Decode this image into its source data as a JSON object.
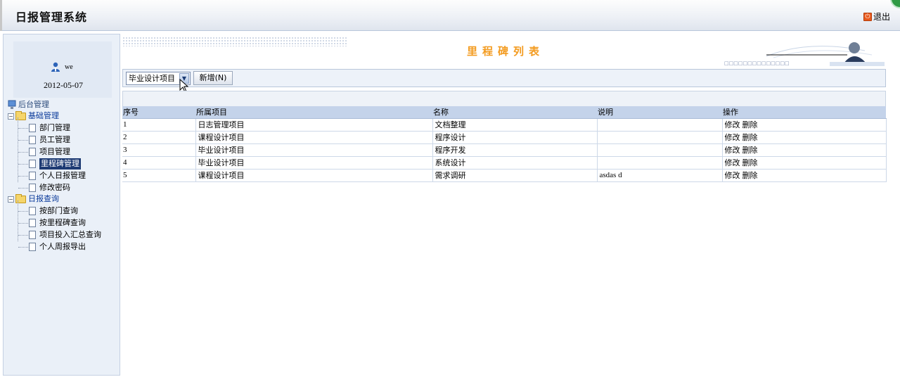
{
  "header": {
    "app_title": "日报管理系统",
    "logout_label": "退出"
  },
  "sidebar": {
    "user_name": "we",
    "login_date": "2012-05-07",
    "tree": {
      "root_label": "后台管理",
      "groups": [
        {
          "label": "基础管理",
          "items": [
            {
              "label": "部门管理"
            },
            {
              "label": "员工管理"
            },
            {
              "label": "项目管理"
            },
            {
              "label": "里程碑管理",
              "selected": true
            },
            {
              "label": "个人日报管理"
            },
            {
              "label": "修改密码"
            }
          ]
        },
        {
          "label": "日报查询",
          "items": [
            {
              "label": "按部门查询"
            },
            {
              "label": "按里程碑查询"
            },
            {
              "label": "项目投入汇总查询"
            },
            {
              "label": "个人周报导出"
            }
          ]
        }
      ]
    }
  },
  "main": {
    "page_title": "里程碑列表",
    "banner_squares": "□□□□□□□□□□□□□□",
    "toolbar": {
      "project_select_value": "毕业设计项目",
      "add_button_label": "新增(N)"
    },
    "table": {
      "columns": [
        "序号",
        "所属项目",
        "名称",
        "说明",
        "操作"
      ],
      "rows": [
        {
          "no": "1",
          "project": "日志管理项目",
          "name": "文档整理",
          "desc": "",
          "edit": "修改",
          "delete": "删除"
        },
        {
          "no": "2",
          "project": "课程设计项目",
          "name": "程序设计",
          "desc": "",
          "edit": "修改",
          "delete": "删除"
        },
        {
          "no": "3",
          "project": "毕业设计项目",
          "name": "程序开发",
          "desc": "",
          "edit": "修改",
          "delete": "删除"
        },
        {
          "no": "4",
          "project": "毕业设计项目",
          "name": "系统设计",
          "desc": "",
          "edit": "修改",
          "delete": "删除"
        },
        {
          "no": "5",
          "project": "课程设计项目",
          "name": "需求调研",
          "desc": "asdas d",
          "edit": "修改",
          "delete": "删除"
        }
      ]
    }
  },
  "colors": {
    "title_orange": "#f39b1f",
    "header_row_blue": "#c4d3ea",
    "folder_label_blue": "#0a3a9a",
    "selected_bg": "#1d3a73"
  }
}
